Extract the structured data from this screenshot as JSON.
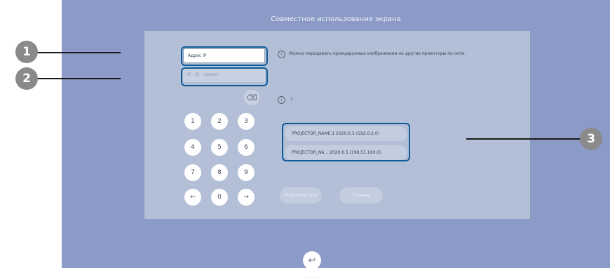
{
  "screen": {
    "title": "Совместное использование экрана",
    "address_field": {
      "value": "Адрес IP"
    },
    "port_field": {
      "placeholder": "IP · ID · проект"
    },
    "backspace_icon": "backspace-icon",
    "keypad": [
      "1",
      "2",
      "3",
      "4",
      "5",
      "6",
      "7",
      "8",
      "9",
      "←",
      "0",
      "→"
    ],
    "info_text": "Можно передавать проецируемые изображения на другие проекторы по сети.",
    "projector_count": "1",
    "projectors": [
      "PROJECTOR_NAME:1   2020.6.5 (192.0.2.0)",
      "PROJECTOR_NA...   2020.6.5 (198.51.100.0)"
    ],
    "connect_label": "Подключиться",
    "cancel_label": "Отмена",
    "back_label": "Назад"
  },
  "callouts": [
    "1",
    "2",
    "3"
  ],
  "colors": {
    "screen_bg": "#8c9ac7",
    "panel_bg": "#b3bfd6",
    "highlight": "#0b5b99",
    "callout": "#8a8a8a"
  }
}
